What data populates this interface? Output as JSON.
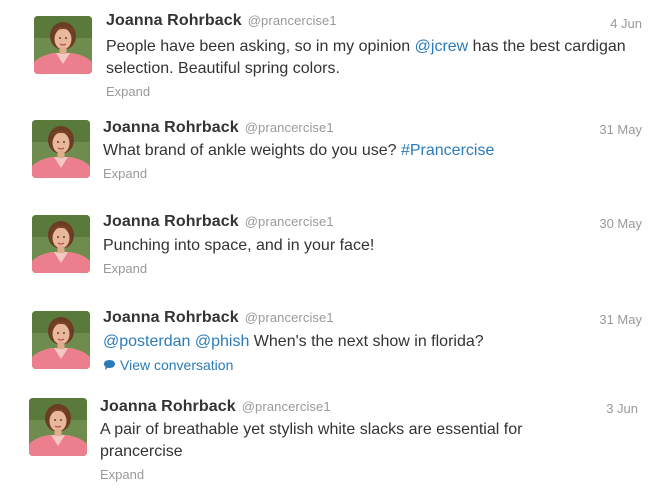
{
  "tweets": [
    {
      "name": "Joanna Rohrback",
      "handle": "@prancercise1",
      "time": "4 Jun",
      "text_parts": [
        {
          "t": "People have been asking, so in my opinion "
        },
        {
          "t": "@jcrew",
          "link": true
        },
        {
          "t": " has the best cardigan selection. Beautiful spring colors."
        }
      ],
      "action": "Expand"
    },
    {
      "name": "Joanna Rohrback",
      "handle": "@prancercise1",
      "time": "31 May",
      "text_parts": [
        {
          "t": "What brand of ankle weights do you use? "
        },
        {
          "t": "#Prancercise",
          "link": true
        }
      ],
      "action": "Expand"
    },
    {
      "name": "Joanna Rohrback",
      "handle": "@prancercise1",
      "time": "30 May",
      "text_parts": [
        {
          "t": "Punching into space, and in your face!"
        }
      ],
      "action": "Expand"
    },
    {
      "name": "Joanna Rohrback",
      "handle": "@prancercise1",
      "time": "31 May",
      "text_parts": [
        {
          "t": "@posterdan",
          "link": true
        },
        {
          "t": " "
        },
        {
          "t": "@phish",
          "link": true
        },
        {
          "t": " When's the next show in florida?"
        }
      ],
      "action": "View conversation",
      "action_icon": "speech-bubble-icon"
    },
    {
      "name": "Joanna Rohrback",
      "handle": "@prancercise1",
      "time": "3 Jun",
      "text_parts": [
        {
          "t": "A pair of breathable yet stylish white slacks are essential for prancercise"
        }
      ],
      "action": "Expand"
    }
  ],
  "colors": {
    "link": "#2b7bb9",
    "meta": "#999999",
    "text": "#333333"
  }
}
